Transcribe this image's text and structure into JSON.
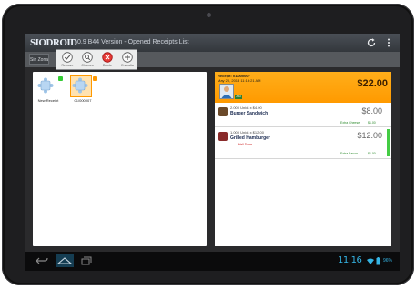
{
  "app": {
    "logo": "SIODROID",
    "title": "0.9 B44 Version - Opened Receipts List"
  },
  "subbar": {
    "zone_tab": "Sin Zona"
  },
  "toolbar": {
    "buttons": [
      {
        "label": "Remove",
        "icon": "check-icon"
      },
      {
        "label": "Charnes",
        "icon": "search-icon"
      },
      {
        "label": "Delete",
        "icon": "delete-icon"
      },
      {
        "label": "Enchalia",
        "icon": "add-icon"
      }
    ]
  },
  "tables": [
    {
      "label": "New Receipt",
      "badge_color": "#33cc33"
    },
    {
      "label": "01/000007",
      "badge_color": "#ff9900"
    }
  ],
  "receipt": {
    "number": "Receipt: 01/000007",
    "date": "May 20, 2013 11:16:21 AM",
    "total": "$22.00",
    "badge": "Add",
    "items": [
      {
        "qty_line": "2.000 Unid.  x $4.00",
        "name": "Burger Sandwich",
        "price": "$8.00",
        "modifier": "Extra Cheese",
        "modifier_price": "$1.00",
        "note": "",
        "thumb_color": "#6b4a2a"
      },
      {
        "qty_line": "1.000 Unid.  x $12.00",
        "name": "Grilled Hamburger",
        "price": "$12.00",
        "modifier": "Extra Bacon",
        "modifier_price": "$1.00",
        "note": "Well Done",
        "thumb_color": "#8a2b2b"
      }
    ]
  },
  "status_bar": {
    "time": "11:16",
    "battery": "96%"
  },
  "colors": {
    "accent": "#ff9a00",
    "clock": "#35b5e5"
  }
}
